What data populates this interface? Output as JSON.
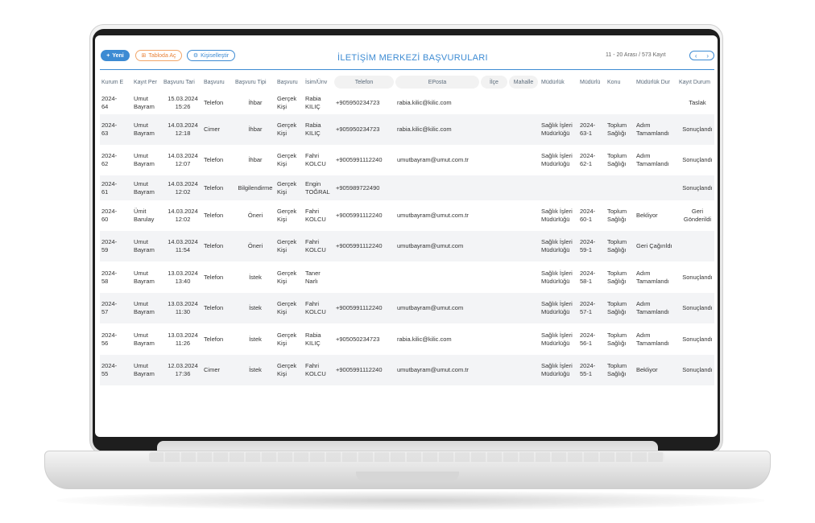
{
  "toolbar": {
    "new_label": "Yeni",
    "table_label": "Tabloda Aç",
    "customize_label": "Kişiselleştir"
  },
  "page_title": "İLETİŞİM MERKEZİ BAŞVURULARI",
  "pagination": {
    "range_text": "11 - 20 Arası  /  573 Kayıt",
    "prev_symbol": "‹",
    "next_symbol": "›"
  },
  "columns": [
    "Kurum E",
    "Kayıt Per",
    "Başvuru Tari",
    "Başvuru",
    "Başvuru Tipi",
    "Başvuru",
    "İsim/Ünv",
    "Telefon",
    "EPosta",
    "İlçe",
    "Mahalle",
    "Müdürlük",
    "Müdürlü",
    "Konu",
    "Müdürlük Dur",
    "Kayıt Durum"
  ],
  "rows": [
    {
      "kurum": "2024-64",
      "kayit": "Umut Bayram",
      "tarih": "15.03.2024 15:26",
      "basvuru": "Telefon",
      "tip": "İhbar",
      "kisi": "Gerçek Kişi",
      "isim": "Rabia KILIÇ",
      "telefon": "+905950234723",
      "eposta": "rabia.kilic@kilic.com",
      "ilce": "",
      "mahalle": "",
      "mudurluk": "",
      "mudurlu_no": "",
      "konu": "",
      "mudurluk_durum": "",
      "kayit_durum": "Taslak"
    },
    {
      "kurum": "2024-63",
      "kayit": "Umut Bayram",
      "tarih": "14.03.2024 12:18",
      "basvuru": "Cimer",
      "tip": "İhbar",
      "kisi": "Gerçek Kişi",
      "isim": "Rabia KILIÇ",
      "telefon": "+905950234723",
      "eposta": "rabia.kilic@kilic.com",
      "ilce": "",
      "mahalle": "",
      "mudurluk": "Sağlık İşleri Müdürlüğü",
      "mudurlu_no": "2024-63-1",
      "konu": "Toplum Sağlığı",
      "mudurluk_durum": "Adım Tamamlandı",
      "kayit_durum": "Sonuçlandı"
    },
    {
      "kurum": "2024-62",
      "kayit": "Umut Bayram",
      "tarih": "14.03.2024 12:07",
      "basvuru": "Telefon",
      "tip": "İhbar",
      "kisi": "Gerçek Kişi",
      "isim": "Fahri KOLCU",
      "telefon": "+9005991112240",
      "eposta": "umutbayram@umut.com.tr",
      "ilce": "",
      "mahalle": "",
      "mudurluk": "Sağlık İşleri Müdürlüğü",
      "mudurlu_no": "2024-62-1",
      "konu": "Toplum Sağlığı",
      "mudurluk_durum": "Adım Tamamlandı",
      "kayit_durum": "Sonuçlandı"
    },
    {
      "kurum": "2024-61",
      "kayit": "Umut Bayram",
      "tarih": "14.03.2024 12:02",
      "basvuru": "Telefon",
      "tip": "Bilgilendirme",
      "kisi": "Gerçek Kişi",
      "isim": "Engin TOĞRAL",
      "telefon": "+905989722490",
      "eposta": "",
      "ilce": "",
      "mahalle": "",
      "mudurluk": "",
      "mudurlu_no": "",
      "konu": "",
      "mudurluk_durum": "",
      "kayit_durum": "Sonuçlandı"
    },
    {
      "kurum": "2024-60",
      "kayit": "Ümit Barulay",
      "tarih": "14.03.2024 12:02",
      "basvuru": "Telefon",
      "tip": "Öneri",
      "kisi": "Gerçek Kişi",
      "isim": "Fahri KOLCU",
      "telefon": "+9005991112240",
      "eposta": "umutbayram@umut.com.tr",
      "ilce": "",
      "mahalle": "",
      "mudurluk": "Sağlık İşleri Müdürlüğü",
      "mudurlu_no": "2024-60-1",
      "konu": "Toplum Sağlığı",
      "mudurluk_durum": "Bekliyor",
      "kayit_durum": "Geri Gönderildi"
    },
    {
      "kurum": "2024-59",
      "kayit": "Umut Bayram",
      "tarih": "14.03.2024 11:54",
      "basvuru": "Telefon",
      "tip": "Öneri",
      "kisi": "Gerçek Kişi",
      "isim": "Fahri KOLCU",
      "telefon": "+9005991112240",
      "eposta": "umutbayram@umut.com",
      "ilce": "",
      "mahalle": "",
      "mudurluk": "Sağlık İşleri Müdürlüğü",
      "mudurlu_no": "2024-59-1",
      "konu": "Toplum Sağlığı",
      "mudurluk_durum": "Geri Çağırıldı",
      "kayit_durum": ""
    },
    {
      "kurum": "2024-58",
      "kayit": "Umut Bayram",
      "tarih": "13.03.2024 13:40",
      "basvuru": "Telefon",
      "tip": "İstek",
      "kisi": "Gerçek Kişi",
      "isim": "Taner Narlı",
      "telefon": "",
      "eposta": "",
      "ilce": "",
      "mahalle": "",
      "mudurluk": "Sağlık İşleri Müdürlüğü",
      "mudurlu_no": "2024-58-1",
      "konu": "Toplum Sağlığı",
      "mudurluk_durum": "Adım Tamamlandı",
      "kayit_durum": "Sonuçlandı"
    },
    {
      "kurum": "2024-57",
      "kayit": "Umut Bayram",
      "tarih": "13.03.2024 11:30",
      "basvuru": "Telefon",
      "tip": "İstek",
      "kisi": "Gerçek Kişi",
      "isim": "Fahri KOLCU",
      "telefon": "+9005991112240",
      "eposta": "umutbayram@umut.com",
      "ilce": "",
      "mahalle": "",
      "mudurluk": "Sağlık İşleri Müdürlüğü",
      "mudurlu_no": "2024-57-1",
      "konu": "Toplum Sağlığı",
      "mudurluk_durum": "Adım Tamamlandı",
      "kayit_durum": "Sonuçlandı"
    },
    {
      "kurum": "2024-56",
      "kayit": "Umut Bayram",
      "tarih": "13.03.2024 11:26",
      "basvuru": "Telefon",
      "tip": "İstek",
      "kisi": "Gerçek Kişi",
      "isim": "Rabia KILIÇ",
      "telefon": "+905050234723",
      "eposta": "rabia.kilic@kilic.com",
      "ilce": "",
      "mahalle": "",
      "mudurluk": "Sağlık İşleri Müdürlüğü",
      "mudurlu_no": "2024-56-1",
      "konu": "Toplum Sağlığı",
      "mudurluk_durum": "Adım Tamamlandı",
      "kayit_durum": "Sonuçlandı"
    },
    {
      "kurum": "2024-55",
      "kayit": "Umut Bayram",
      "tarih": "12.03.2024 17:36",
      "basvuru": "Cimer",
      "tip": "İstek",
      "kisi": "Gerçek Kişi",
      "isim": "Fahri KOLCU",
      "telefon": "+9005991112240",
      "eposta": "umutbayram@umut.com.tr",
      "ilce": "",
      "mahalle": "",
      "mudurluk": "Sağlık İşleri Müdürlüğü",
      "mudurlu_no": "2024-55-1",
      "konu": "Toplum Sağlığı",
      "mudurluk_durum": "Bekliyor",
      "kayit_durum": "Sonuçlandı"
    }
  ]
}
